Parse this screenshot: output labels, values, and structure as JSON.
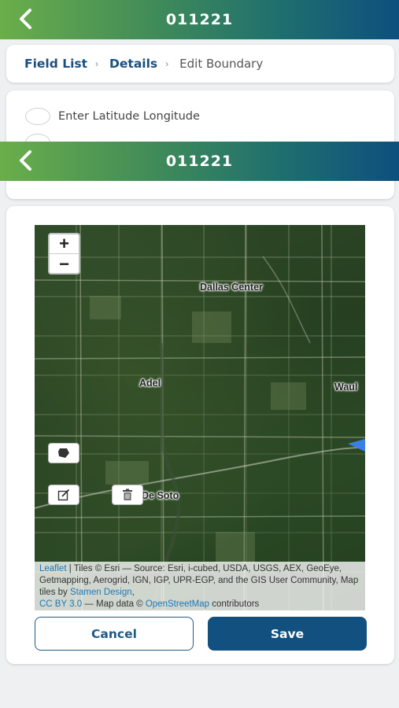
{
  "header": {
    "title": "011221",
    "back_icon": "chevron-left-icon"
  },
  "breadcrumb": {
    "items": [
      {
        "label": "Field List",
        "link": true
      },
      {
        "label": "Details",
        "link": true
      },
      {
        "label": "Edit Boundary",
        "link": false
      }
    ],
    "separator": "›"
  },
  "coordinates": {
    "option_label": "Enter Latitude Longitude"
  },
  "map": {
    "zoom_in": "+",
    "zoom_out": "−",
    "towns": [
      "Dallas Center",
      "Adel",
      "Waul",
      "De Soto"
    ],
    "tools": [
      "draw-polygon-icon",
      "edit-icon",
      "delete-icon"
    ],
    "attribution": {
      "leaflet": "Leaflet",
      "tiles": " | Tiles © Esri — Source: Esri, i-cubed, USDA, USGS, AEX, GeoEye, Getmapping, Aerogrid, IGN, IGP, UPR-EGP, and the GIS User Community, Map tiles by ",
      "stamen": "Stamen Design",
      "comma": ",",
      "ccby": "CC BY 3.0",
      "mapdata": " — Map data © ",
      "osm": "OpenStreetMap",
      "contrib": " contributors"
    }
  },
  "actions": {
    "cancel": "Cancel",
    "save": "Save"
  },
  "colors": {
    "primary": "#11507f",
    "link": "#1a4f7e"
  }
}
